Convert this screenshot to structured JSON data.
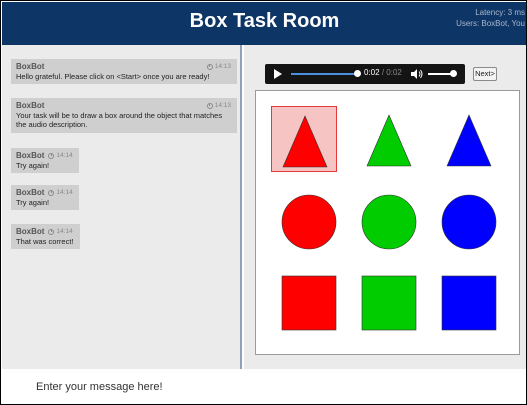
{
  "header": {
    "title": "Box Task Room",
    "latency_line": "Latency: 3 ms",
    "users_line": "Users: BoxBot, You"
  },
  "chat": {
    "messages": [
      {
        "author": "BoxBot",
        "time": "14:13",
        "text": "Hello grateful. Please click on <Start> once you are ready!"
      },
      {
        "author": "BoxBot",
        "time": "14:13",
        "text": "Your task will be to draw a box around the object that matches the audio description."
      },
      {
        "author": "BoxBot",
        "time": "14:14",
        "text": "Try again!"
      },
      {
        "author": "BoxBot",
        "time": "14:14",
        "text": "Try again!"
      },
      {
        "author": "BoxBot",
        "time": "14:14",
        "text": "That was correct!"
      }
    ]
  },
  "player": {
    "current_time": "0:02",
    "separator": "/",
    "duration": "0:02",
    "progress_fraction": 1.0,
    "volume_fraction": 1.0,
    "icons": [
      "play-icon",
      "volume-icon"
    ]
  },
  "next_button_label": "Next>",
  "shapes": [
    {
      "shape": "triangle",
      "color": "#ff0000",
      "selected": true
    },
    {
      "shape": "triangle",
      "color": "#00cc00",
      "selected": false
    },
    {
      "shape": "triangle",
      "color": "#0000ff",
      "selected": false
    },
    {
      "shape": "circle",
      "color": "#ff0000",
      "selected": false
    },
    {
      "shape": "circle",
      "color": "#00cc00",
      "selected": false
    },
    {
      "shape": "circle",
      "color": "#0000ff",
      "selected": false
    },
    {
      "shape": "square",
      "color": "#ff0000",
      "selected": false
    },
    {
      "shape": "square",
      "color": "#00cc00",
      "selected": false
    },
    {
      "shape": "square",
      "color": "#0000ff",
      "selected": false
    }
  ],
  "message_input": {
    "placeholder": "Enter your message here!",
    "value": ""
  },
  "colors": {
    "header_bg": "#0d3565",
    "panel_bg": "#ebebeb",
    "bubble_bg": "#cfcfcf",
    "selection": "#e23a3a"
  }
}
